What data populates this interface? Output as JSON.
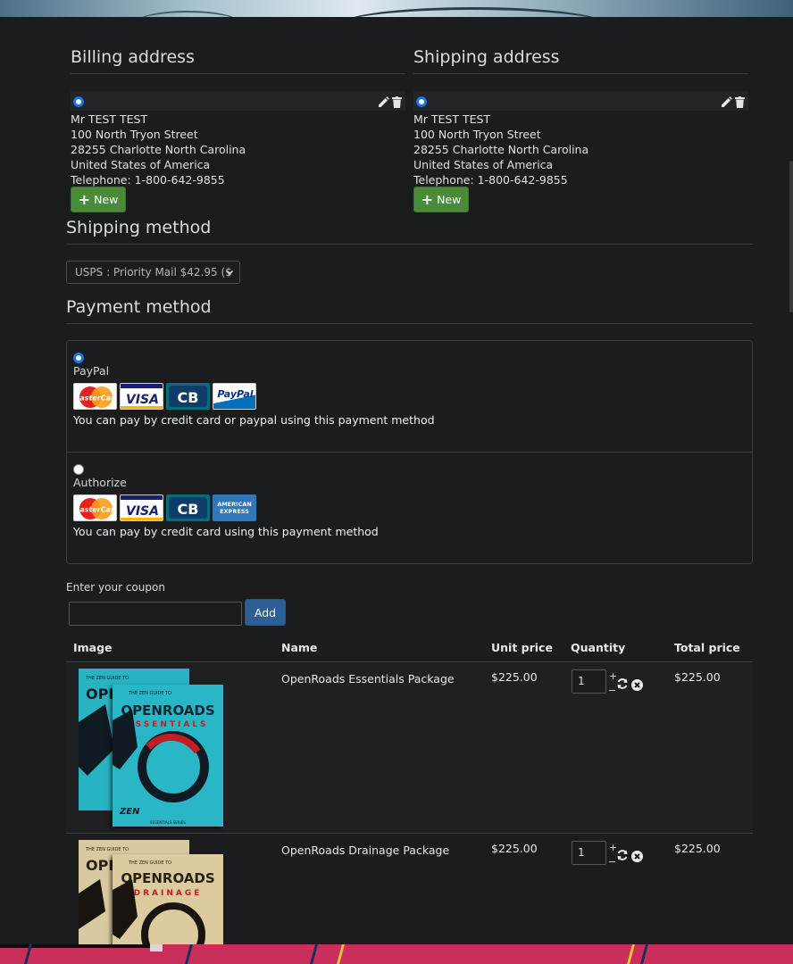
{
  "billing": {
    "title": "Billing address",
    "name": "Mr TEST TEST",
    "street": "100 North Tryon Street",
    "city_line": "28255 Charlotte North Carolina",
    "country": "United States of America",
    "phone": "Telephone: 1-800-642-9855",
    "new_label": "New"
  },
  "shipping": {
    "title": "Shipping address",
    "name": "Mr TEST TEST",
    "street": "100 North Tryon Street",
    "city_line": "28255 Charlotte North Carolina",
    "country": "United States of America",
    "phone": "Telephone: 1-800-642-9855",
    "new_label": "New"
  },
  "shipping_method": {
    "title": "Shipping method",
    "selected": "USPS : Priority Mail $42.95 ($"
  },
  "payment": {
    "title": "Payment method",
    "methods": [
      {
        "label": "PayPal",
        "selected": true,
        "cards": [
          "MasterCard",
          "VISA",
          "CB",
          "PayPal"
        ],
        "description": "You can pay by credit card or paypal using this payment method"
      },
      {
        "label": "Authorize",
        "selected": false,
        "cards": [
          "MasterCard",
          "VISA",
          "CB",
          "AMERICAN EXPRESS"
        ],
        "description": "You can pay by credit card using this payment method"
      }
    ]
  },
  "coupon": {
    "label": "Enter your coupon",
    "value": "",
    "add_label": "Add"
  },
  "cart": {
    "headers": [
      "Image",
      "Name",
      "Unit price",
      "Quantity",
      "Total price"
    ],
    "rows": [
      {
        "name": "OpenRoads Essentials Package",
        "unit_price": "$225.00",
        "quantity": "1",
        "total": "$225.00",
        "book_title": "OPENROADS",
        "book_subtitle": "ESSENTIALS",
        "book_header": "THE ZEN GUIDE TO",
        "book_series": "ESSENTIALS SERIES",
        "book_logo": "ZEN"
      },
      {
        "name": "OpenRoads Drainage Package",
        "unit_price": "$225.00",
        "quantity": "1",
        "total": "$225.00",
        "book_title": "OPENROADS",
        "book_subtitle": "DRAINAGE",
        "book_header": "THE ZEN GUIDE TO"
      }
    ],
    "qty_plus": "+",
    "qty_minus": "−"
  },
  "colors": {
    "accent_green": "#4a8b3a",
    "accent_blue": "#2d5f95",
    "radio_blue": "#1a73e8",
    "background": "#1b1c1e"
  }
}
